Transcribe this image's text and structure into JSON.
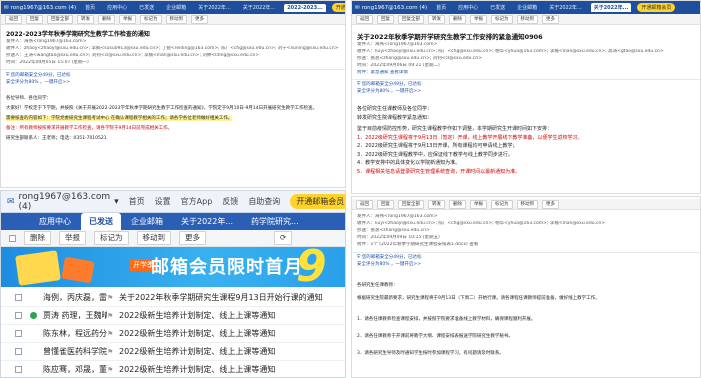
{
  "pane1": {
    "account": "rong1967@163.com (4)",
    "nav": [
      "首页",
      "应用中心",
      "已发送",
      "企业邮箱",
      "关于2022年...",
      "关于2022年...",
      "2022-2023..."
    ],
    "promo": "开通邮箱会员",
    "toolbar": [
      "返回",
      "回复",
      "回复全部",
      "转发",
      "删除",
      "举报",
      "标记为",
      "移动到",
      "更多"
    ],
    "subject": "2022-2023学年秋季学期研究生教学工作检查的通知",
    "meta": [
      "发件人：海燕<rong1967@163.com>",
      "收件人：zhaoy<zhaoyl@sxu.edu.cn>; 李楠<susu0913@sxu.edu.cn>; 丁锐<reiding@163.com>; 陈广<chg@sxu.edu.cn>; 刘宁<liuning@sxu.edu.cn>",
      "抄送人：王涛<wangtao@sxu.edu.cn>; 刘钊<cl@sxu.edu.cn>; 李楠<lnan@sxu.edu.cn>; 刘婷<liting@sxu.edu.cn>",
      "时间：2022年09月05日 15:07 (星期一)"
    ],
    "notice1": "您的邮箱安全分49分，已达标",
    "notice2": "安全评分为80% ，一键开启>>",
    "body": [
      "各位导师、各位同学：",
      "大家好！学校定于下学期，并按照《关于开展2022-2023学年秋季学期研究生教学工作检查的通知》，学院定于9月10日-9月14日开展研究生教学工作检查。",
      "需要核查的内容如下：学院党委研究生课程考试中心 在确认课程教学相关的工作；请各学各位老师做好相关工作。",
      "备注：所有教师按照要求开展教学工作检查，请各学院于9月14日前完成相关工作。",
      "研究生部联系人：王老师；电话：0351-7010521"
    ]
  },
  "pane2": {
    "account": "rong1967@163.com (4)",
    "nav": [
      "首页",
      "应用中心",
      "已发送",
      "企业邮箱",
      "关于2022年...",
      "关于2022年..."
    ],
    "promo": "开通邮箱会员",
    "toolbar": [
      "返回",
      "回复",
      "回复全部",
      "转发",
      "删除",
      "举报",
      "标记为",
      "移动到",
      "更多"
    ],
    "subject": "关于2022年秋季学期开学研究生教学工作安排的紧急通知0906",
    "meta": [
      "发件人：海燕<rong1967@163.com>",
      "收件人：liuyi<zhaoyl@sxu.edu.cn>; 陈广<chg@sxu.edu.cn>; 杨华<yhua@163.com>; 李楠<lnan@sxu.edu.cn>; 高涛<gtao@sxu.edu.cn>",
      "抄送：张总<zhang@sxu.edu.cn>; 刘钊<cl@sxu.edu.cn>",
      "时间：2022年09月06日 09:21 (星期二)"
    ],
    "attach": "附件：紧急通知  查看详情",
    "notice1": "您的邮箱安全分49分，已达标",
    "notice2": "安全评分为80% ，一键开启>>",
    "body": [
      "各位研究生任课教师及各位同学：",
      "转发研究生院课程教学紧急通知：",
      "鉴于目前疫情防控形势，研究生课程教学作如下调整，本学期研究生开课时间如下安排：",
      "1．2022级研究生课程将于9月13日（暂定）开课，线上教学开展线下教学准备，以便学生返校学习。",
      "2．2022级研究生课程将于9月13日开课，所有课程均可申请线上教学；",
      "3．2022级研究生课程教学中，应保证线下教学与线上教学同步进行。",
      "4．教学安排中的具体变化以学院新通知为准。",
      "5．课程相关信息请登录研究生管理系统查询，开课时间以最新通知为准。"
    ]
  },
  "pane3": {
    "account": "rong1967@163.com (4)",
    "nav": [
      "首页",
      "设置",
      "官方App",
      "反馈",
      "自助查询"
    ],
    "promo": "开通邮箱会员",
    "tabs": [
      "应用中心",
      "已发送",
      "企业邮箱",
      "关于2022年...",
      "药学院研究..."
    ],
    "toolbar": [
      "删除",
      "举报",
      "标记为",
      "移动到",
      "更多"
    ],
    "banner_text": "邮箱会员限时首月",
    "banner_tag": "开学季",
    "banner_num": "9",
    "rows": [
      {
        "sender": "海例，丙庆磊，雷...",
        "subject": "关于2022年秋季学期研究生课程9月13日开始行课的通知"
      },
      {
        "sender": "贾涛 药理，王魏晴...",
        "subject": "2022级新生培养计划制定、线上上课等通知"
      },
      {
        "sender": "陈东林，程远药分...",
        "subject": "2022级新生培养计划制定、线上上课等通知"
      },
      {
        "sender": "曾懂雀医药科学院",
        "subject": "2022级新生培养计划制定、线上上课等通知"
      },
      {
        "sender": "陈应骞，邓晟，董...",
        "subject": "2022级新生培养计划制定、线上上课等通知"
      }
    ]
  },
  "pane4": {
    "toolbar": [
      "返回",
      "回复",
      "回复全部",
      "转发",
      "删除",
      "举报",
      "标记为",
      "移动到",
      "更多"
    ],
    "meta": [
      "发件人：海燕<rong1967@163.com>",
      "收件人：liuyi<zhaoyl@sxu.edu.cn>; 陈广<chg@sxu.edu.cn>; 杨华<yhua@163.com>; 李楠<lnan@sxu.edu.cn>",
      "抄送：张总<zhang@sxu.edu.cn>",
      "时间：2022年09月09日 10:15 (星期五)",
      "附件：1个 (2022年秋季学期研究生课程安排表1.docx)  查看"
    ],
    "notice1": "您的邮箱安全分49分，已达标",
    "notice2": "安全评分为80% ，一键开启>>",
    "body": [
      "各研究生任课教师：",
      "根据研究生院最新要求，研究生课程将于9月13日（下周二）开始行课。请各课程任课教师提前准备，做好线上教学工作。",
      "1．请各任课教师检查课程安排，并按照学院要求准备线上教学材料，确保课程顺利开展。",
      "2．请各任课教师于开课前将教学大纲、课程安排表报送学院研究生教学秘书。",
      "3．请各研究生导师及时通知学生按时参加课程学习，有问题请及时联系。"
    ]
  },
  "colors": {
    "navy": "#1f4e9c",
    "blue": "#2b5fb6",
    "red": "#d20000",
    "promo": "#ffd32a"
  }
}
